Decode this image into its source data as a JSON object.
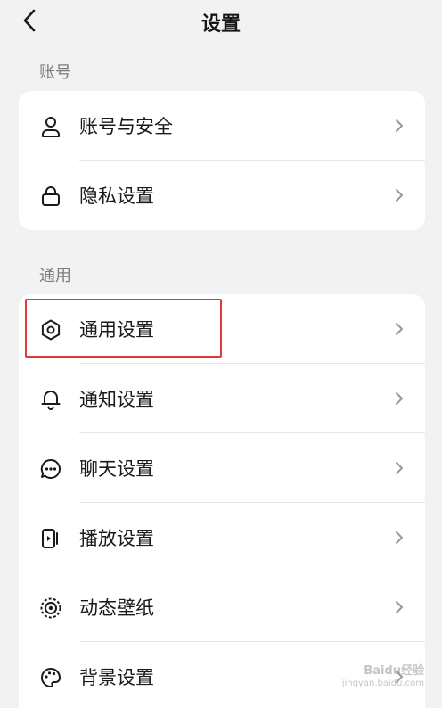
{
  "header": {
    "title": "设置"
  },
  "sections": [
    {
      "label": "账号",
      "items": [
        {
          "label": "账号与安全"
        },
        {
          "label": "隐私设置"
        }
      ]
    },
    {
      "label": "通用",
      "items": [
        {
          "label": "通用设置"
        },
        {
          "label": "通知设置"
        },
        {
          "label": "聊天设置"
        },
        {
          "label": "播放设置"
        },
        {
          "label": "动态壁纸"
        },
        {
          "label": "背景设置"
        }
      ]
    }
  ],
  "watermark": {
    "brand": "Baidu经验",
    "url": "jingyan.baidu.com"
  },
  "colors": {
    "background": "#f2f2f2",
    "card": "#ffffff",
    "highlight": "#e53935",
    "section_text": "#7c7c7c"
  },
  "icons": [
    "back-icon",
    "user-icon",
    "lock-icon",
    "gear-icon",
    "bell-icon",
    "chat-icon",
    "play-device-icon",
    "live-wallpaper-icon",
    "palette-icon",
    "chevron-right-icon"
  ]
}
